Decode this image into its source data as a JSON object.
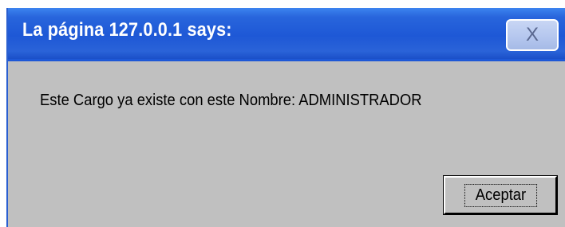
{
  "dialog": {
    "title": "La página 127.0.0.1 says:",
    "close_label": "X",
    "message": "Este Cargo ya existe con este Nombre: ADMINISTRADOR",
    "ok_label": "Aceptar"
  }
}
